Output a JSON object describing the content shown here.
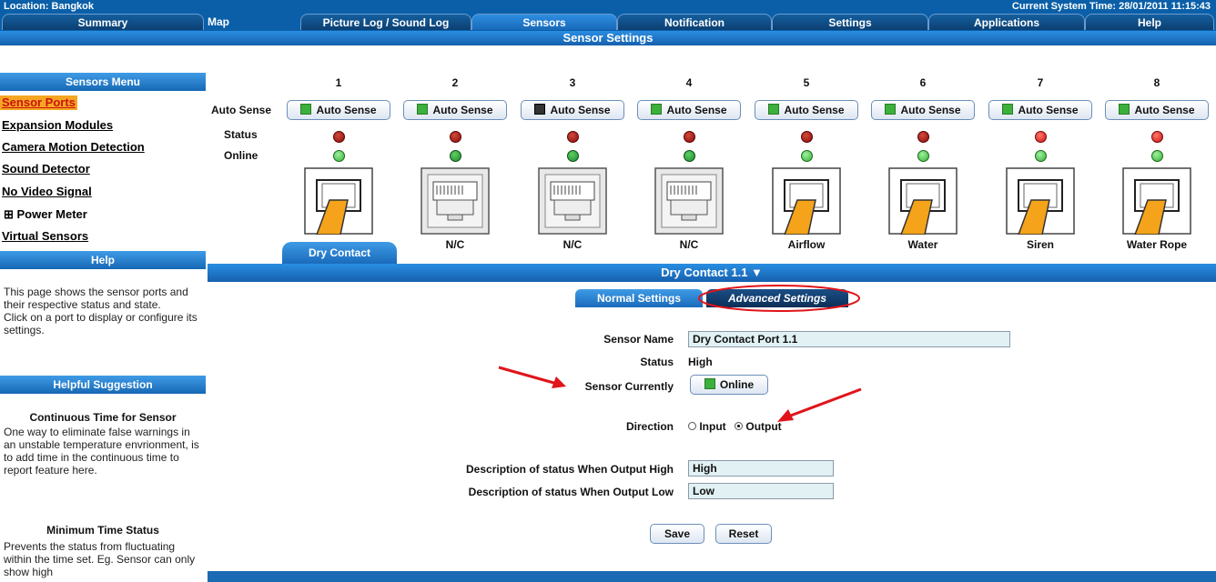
{
  "header": {
    "location": "Location: Bangkok",
    "time": "Current System Time: 28/01/2011 11:15:43"
  },
  "nav_tabs": [
    "Summary",
    "Map",
    "Picture Log / Sound Log",
    "Sensors",
    "Notification",
    "Settings",
    "Applications",
    "Help"
  ],
  "active_tab": "Sensors",
  "page_title": "Sensor Settings",
  "sidebar": {
    "menu_title": "Sensors Menu",
    "items": [
      "Sensor Ports",
      "Expansion Modules",
      "Camera Motion Detection",
      "Sound Detector",
      "No Video Signal",
      "⊞ Power Meter",
      "Virtual Sensors"
    ],
    "help_title": "Help",
    "help_text": "This page shows the sensor ports and their respective status and state.\nClick on a port to display or configure its settings.",
    "suggestion_title": "Helpful Suggestion",
    "tips": [
      {
        "title": "Continuous Time for Sensor",
        "text": "One way to eliminate false warnings in an unstable temperature envrionment, is to add time in the continuous time to report feature here."
      },
      {
        "title": "Minimum Time Status",
        "text": "Prevents the status from fluctuating within the time set. Eg. Sensor can only show high"
      }
    ]
  },
  "ports": {
    "row_labels": {
      "auto_sense": "Auto Sense",
      "status": "Status",
      "online": "Online"
    },
    "items": [
      {
        "num": "1",
        "button": "Auto Sense",
        "label": "Dry Contact"
      },
      {
        "num": "2",
        "button": "Auto Sense",
        "label": "N/C"
      },
      {
        "num": "3",
        "button": "Auto Sense",
        "label": "N/C"
      },
      {
        "num": "4",
        "button": "Auto Sense",
        "label": "N/C"
      },
      {
        "num": "5",
        "button": "Auto Sense",
        "label": "Airflow"
      },
      {
        "num": "6",
        "button": "Auto Sense",
        "label": "Water"
      },
      {
        "num": "7",
        "button": "Auto Sense",
        "label": "Siren"
      },
      {
        "num": "8",
        "button": "Auto Sense",
        "label": "Water Rope"
      }
    ]
  },
  "panel": {
    "title": "Dry Contact 1.1 ▼",
    "tabs": [
      "Normal Settings",
      "Advanced Settings"
    ],
    "fields": {
      "sensor_name_label": "Sensor Name",
      "sensor_name_value": "Dry Contact Port 1.1",
      "status_label": "Status",
      "status_value": "High",
      "currently_label": "Sensor Currently",
      "currently_value": "Online",
      "direction_label": "Direction",
      "direction_options": [
        "Input",
        "Output"
      ],
      "high_label": "Description of status When Output High",
      "high_value": "High",
      "low_label": "Description of status When Output Low",
      "low_value": "Low"
    },
    "buttons": {
      "save": "Save",
      "reset": "Reset"
    }
  }
}
